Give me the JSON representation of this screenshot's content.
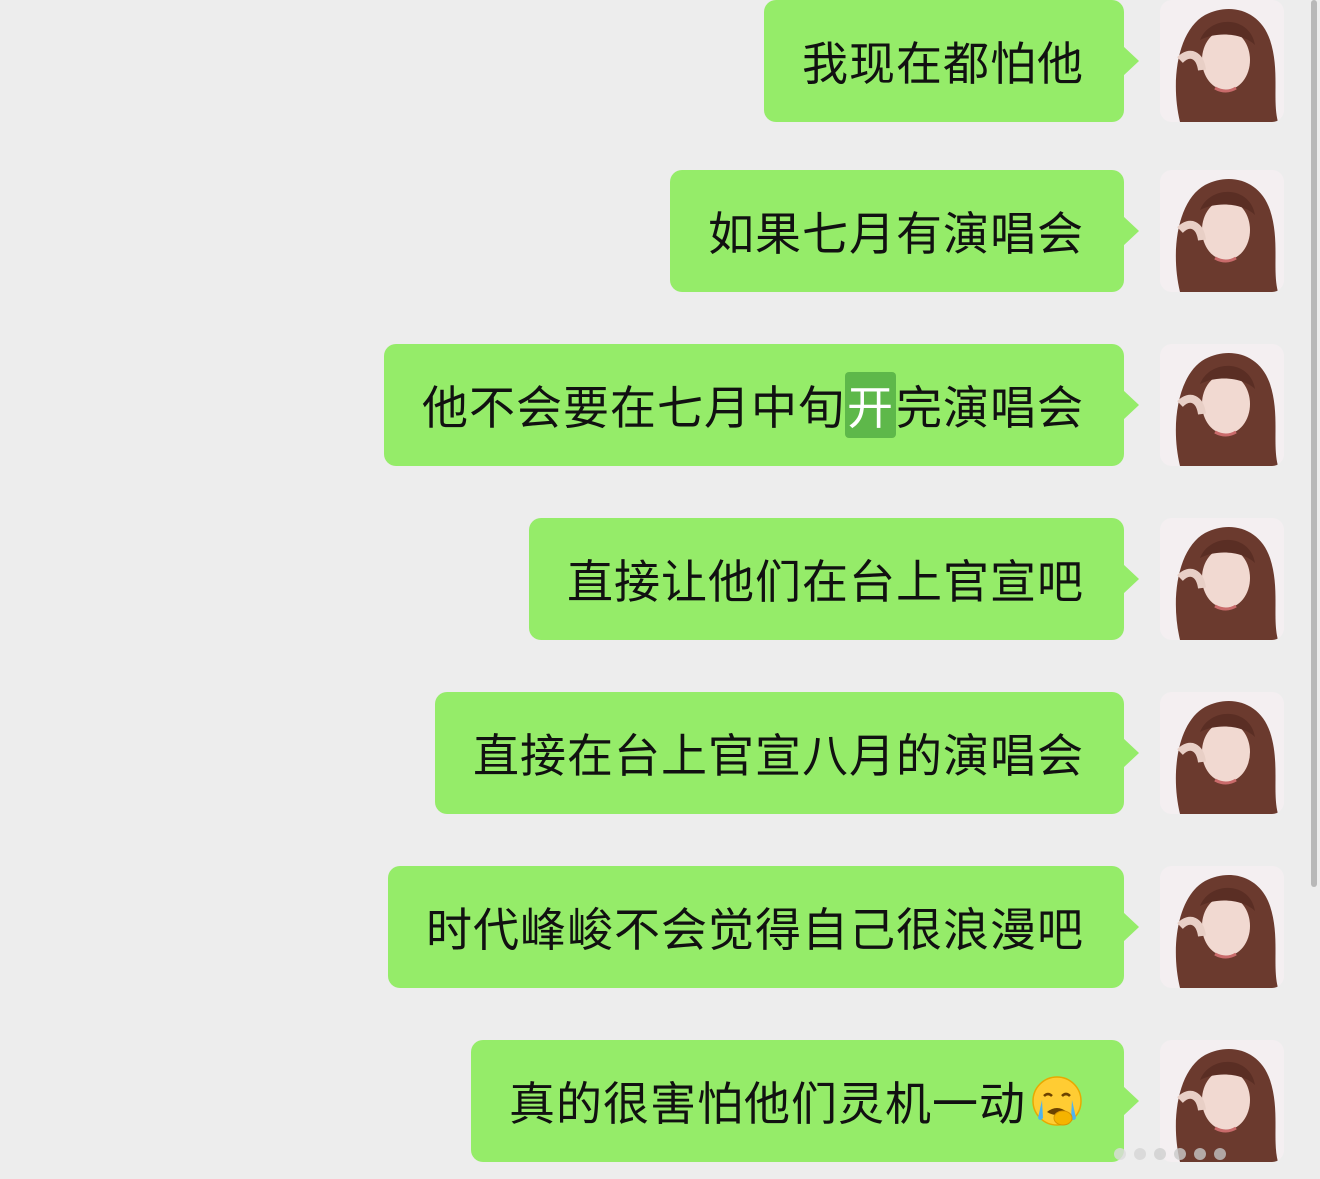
{
  "messages": [
    {
      "text": "我现在都怕他"
    },
    {
      "text": "如果七月有演唱会"
    },
    {
      "text_before": "他不会要在七月中旬",
      "text_highlight": "开",
      "text_after": "完演唱会"
    },
    {
      "text": "直接让他们在台上官宣吧"
    },
    {
      "text": "直接在台上官宣八月的演唱会"
    },
    {
      "text": "时代峰峻不会觉得自己很浪漫吧"
    },
    {
      "text": "真的很害怕他们灵机一动",
      "emoji": "crying-face-icon"
    }
  ],
  "colors": {
    "background": "#ededed",
    "bubble": "#95ec69",
    "highlight": "#5eb84a"
  }
}
